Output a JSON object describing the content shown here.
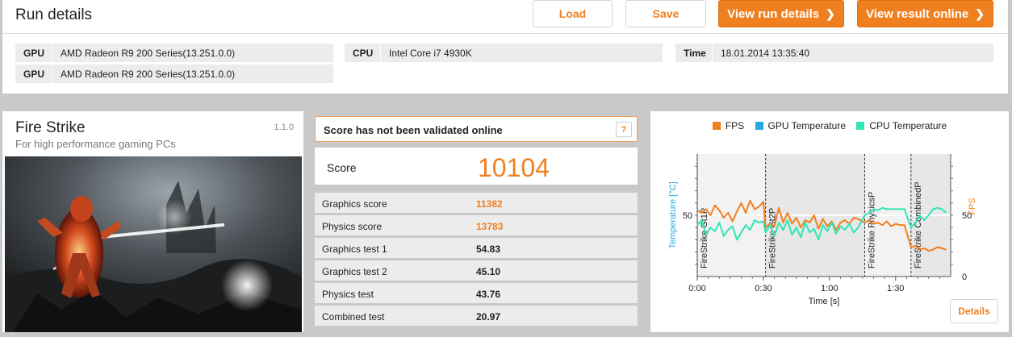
{
  "header": {
    "title": "Run details",
    "load_label": "Load",
    "save_label": "Save",
    "view_run_label": "View run details",
    "view_result_label": "View result online"
  },
  "system": {
    "gpu_label": "GPU",
    "gpu1": "AMD Radeon R9 200 Series(13.251.0.0)",
    "gpu2": "AMD Radeon R9 200 Series(13.251.0.0)",
    "cpu_label": "CPU",
    "cpu": "Intel Core i7 4930K",
    "time_label": "Time",
    "time": "18.01.2014 13:35:40"
  },
  "benchmark": {
    "title": "Fire Strike",
    "version": "1.1.0",
    "subtitle": "For high performance gaming PCs"
  },
  "score": {
    "validation_text": "Score has not been validated online",
    "help_label": "?",
    "label": "Score",
    "value": "10104",
    "rows": [
      {
        "label": "Graphics score",
        "value": "11382"
      },
      {
        "label": "Physics score",
        "value": "13783"
      },
      {
        "label": "Graphics test 1",
        "value": "54.83"
      },
      {
        "label": "Graphics test 2",
        "value": "45.10"
      },
      {
        "label": "Physics test",
        "value": "43.76"
      },
      {
        "label": "Combined test",
        "value": "20.97"
      }
    ]
  },
  "chart": {
    "details_label": "Details"
  },
  "colors": {
    "accent": "#f07f1f",
    "fps": "#f07f1f",
    "gpu_temp": "#29a9e0",
    "cpu_temp": "#2fe6b5"
  },
  "chart_data": {
    "type": "line",
    "xlabel": "Time [s]",
    "ylabel_left": "Temperature [°C]",
    "ylabel_right": "FPS",
    "xlim": [
      0,
      115
    ],
    "ylim_left": [
      0,
      100
    ],
    "ylim_right": [
      0,
      100
    ],
    "x_ticks": [
      "0:00",
      "0:30",
      "1:00",
      "1:30"
    ],
    "y_ticks_left": [
      "50"
    ],
    "y_ticks_right": [
      "0",
      "50"
    ],
    "legend_position": "top",
    "sections": [
      {
        "name": "FireStrike Gt1P",
        "start": 0,
        "end": 31
      },
      {
        "name": "FireStrike Gt2P",
        "start": 31,
        "end": 76
      },
      {
        "name": "FireStrike PhysicsP",
        "start": 76,
        "end": 97
      },
      {
        "name": "FireStrike CombinedP",
        "start": 97,
        "end": 115
      }
    ],
    "series": [
      {
        "name": "FPS",
        "axis": "right",
        "color": "#f07f1f",
        "x": [
          0,
          2,
          4,
          6,
          8,
          10,
          12,
          14,
          16,
          18,
          20,
          22,
          24,
          26,
          28,
          30,
          31,
          33,
          35,
          37,
          39,
          41,
          43,
          45,
          47,
          49,
          51,
          53,
          55,
          57,
          59,
          61,
          63,
          65,
          67,
          69,
          71,
          73,
          76,
          78,
          80,
          82,
          84,
          86,
          88,
          90,
          92,
          94,
          97,
          99,
          101,
          103,
          105,
          107,
          109,
          111,
          113
        ],
        "values": [
          54,
          52,
          55,
          50,
          58,
          54,
          48,
          52,
          45,
          53,
          60,
          52,
          62,
          55,
          57,
          61,
          40,
          43,
          41,
          56,
          44,
          52,
          43,
          48,
          40,
          46,
          44,
          50,
          39,
          47,
          41,
          45,
          38,
          44,
          46,
          43,
          48,
          47,
          44,
          46,
          43,
          44,
          42,
          45,
          41,
          43,
          42,
          42,
          24,
          25,
          22,
          23,
          21,
          22,
          24,
          23,
          22
        ]
      },
      {
        "name": "GPU Temperature",
        "axis": "left",
        "color": "#29a9e0",
        "x": [],
        "values": []
      },
      {
        "name": "CPU Temperature",
        "axis": "left",
        "color": "#2fe6b5",
        "x": [
          0,
          2,
          4,
          6,
          8,
          10,
          12,
          14,
          16,
          18,
          20,
          22,
          24,
          26,
          28,
          30,
          31,
          33,
          35,
          37,
          39,
          41,
          43,
          45,
          47,
          49,
          51,
          53,
          55,
          57,
          59,
          61,
          63,
          65,
          67,
          69,
          71,
          73,
          76,
          78,
          80,
          82,
          84,
          86,
          88,
          90,
          92,
          94,
          97,
          99,
          101,
          103,
          105,
          107,
          109,
          111,
          113
        ],
        "values": [
          42,
          46,
          34,
          40,
          37,
          44,
          33,
          38,
          41,
          30,
          36,
          42,
          38,
          46,
          44,
          45,
          36,
          42,
          33,
          44,
          38,
          46,
          34,
          40,
          32,
          44,
          36,
          39,
          30,
          42,
          37,
          44,
          35,
          41,
          38,
          43,
          36,
          40,
          50,
          52,
          55,
          54,
          56,
          55,
          55,
          55,
          55,
          55,
          40,
          44,
          50,
          46,
          50,
          55,
          56,
          55,
          52
        ]
      }
    ]
  }
}
